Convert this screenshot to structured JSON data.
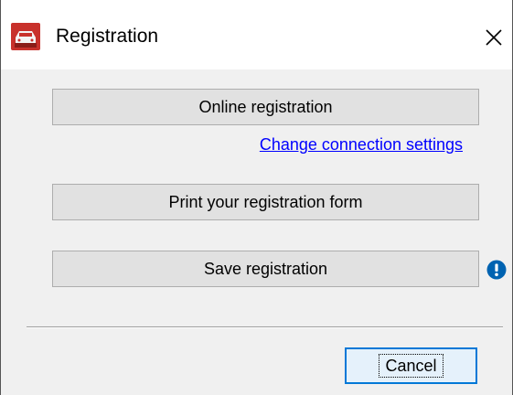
{
  "window": {
    "title": "Registration",
    "app_icon": "red-car-app-icon",
    "close_icon": "close-icon"
  },
  "buttons": {
    "online_registration": "Online registration",
    "print_form": "Print your registration form",
    "save_registration": "Save registration",
    "cancel": "Cancel"
  },
  "links": {
    "change_connection_settings": "Change connection settings"
  },
  "icons": {
    "save_status": "info-icon"
  },
  "colors": {
    "link": "#0000ff",
    "info_icon": "#0063b1",
    "app_icon": "#c8312b",
    "focus_border": "#0078d7"
  }
}
